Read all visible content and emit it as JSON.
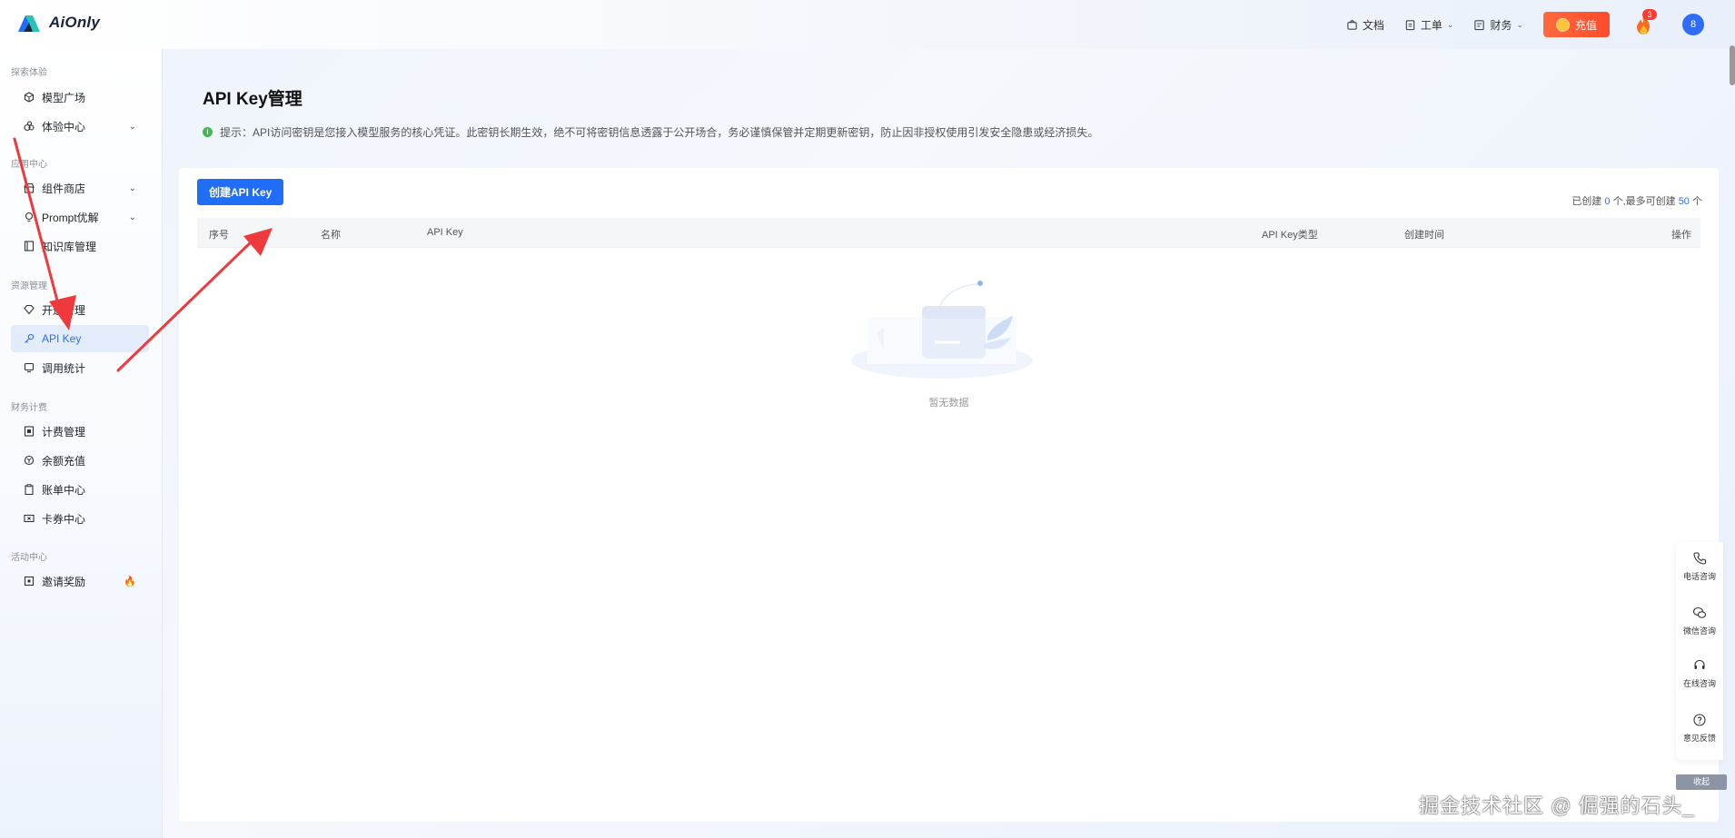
{
  "brand": {
    "name": "AiOnly"
  },
  "header": {
    "docs_label": "文档",
    "ticket_label": "工单",
    "finance_label": "财务",
    "recharge_label": "充值",
    "notify_count": "3",
    "avatar_text": "8"
  },
  "sidebar": {
    "groups": [
      {
        "title": "探索体验",
        "items": [
          {
            "label": "模型广场"
          },
          {
            "label": "体验中心"
          }
        ]
      },
      {
        "title": "应用中心",
        "items": [
          {
            "label": "组件商店"
          },
          {
            "label": "Prompt优解"
          },
          {
            "label": "知识库管理"
          }
        ]
      },
      {
        "title": "资源管理",
        "items": [
          {
            "label": "开通管理"
          },
          {
            "label": "API Key"
          },
          {
            "label": "调用统计"
          }
        ]
      },
      {
        "title": "财务计费",
        "items": [
          {
            "label": "计费管理"
          },
          {
            "label": "余额充值"
          },
          {
            "label": "账单中心"
          },
          {
            "label": "卡券中心"
          }
        ]
      },
      {
        "title": "活动中心",
        "items": [
          {
            "label": "邀请奖励"
          }
        ]
      }
    ]
  },
  "main": {
    "title": "API Key管理",
    "tip": "提示：API访问密钥是您接入模型服务的核心凭证。此密钥长期生效，绝不可将密钥信息透露于公开场合，务必谨慎保管并定期更新密钥，防止因非授权使用引发安全隐患或经济损失。",
    "create_button": "创建API Key",
    "quota": {
      "prefix": "已创建",
      "created": "0",
      "middle": "个,最多可创建",
      "max": "50",
      "suffix": "个"
    },
    "columns": [
      "序号",
      "名称",
      "API Key",
      "API Key类型",
      "创建时间",
      "操作"
    ],
    "empty_text": "暂无数据"
  },
  "float_panel": {
    "items": [
      {
        "label": "电话咨询"
      },
      {
        "label": "微信咨询"
      },
      {
        "label": "在线咨询"
      },
      {
        "label": "意见反馈"
      }
    ],
    "collapse_label": "收起"
  },
  "watermark": "掘金技术社区 @ 倔强的石头_",
  "colors": {
    "accent": "#1f6ef5",
    "recharge": "#ff4b2b",
    "annotation_arrow": "#f0393c"
  }
}
